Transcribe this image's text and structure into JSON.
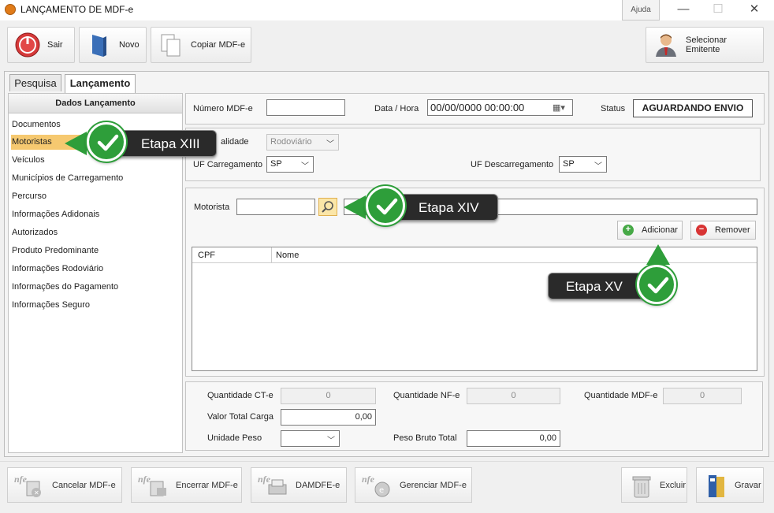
{
  "window": {
    "title": "LANÇAMENTO DE MDF-e",
    "help": "Ajuda",
    "min": "—",
    "max": "☐",
    "close": "✕"
  },
  "toolbar": {
    "exit": "Sair",
    "new": "Novo",
    "copy": "Copiar MDF-e",
    "select_issuer": "Selecionar Emitente"
  },
  "tabs": [
    "Pesquisa",
    "Lançamento"
  ],
  "sidebar": {
    "header": "Dados Lançamento",
    "items": [
      "Documentos",
      "Motoristas",
      "Veículos",
      "Municípios de Carregamento",
      "Percurso",
      "Informações Adidonais",
      "Autorizados",
      "Produto Predominante",
      "Informações Rodoviário",
      "Informações do Pagamento",
      "Informações Seguro"
    ]
  },
  "header_form": {
    "number_label": "Número MDF-e",
    "number_value": "",
    "datetime_label": "Data / Hora",
    "datetime_value": "00/00/0000 00:00:00",
    "status_label": "Status",
    "status_value": "AGUARDANDO ENVIO"
  },
  "mode_form": {
    "modality_label": "alidade",
    "modality_value": "Rodoviário",
    "uf_load_label": "UF Carregamento",
    "uf_load_value": "SP",
    "uf_unload_label": "UF Descarregamento",
    "uf_unload_value": "SP"
  },
  "driver_form": {
    "driver_label": "Motorista",
    "driver_value": "",
    "add_label": "Adicionar",
    "remove_label": "Remover",
    "columns": [
      "CPF",
      "Nome"
    ]
  },
  "totals": {
    "qty_cte_label": "Quantidade CT-e",
    "qty_cte_value": "0",
    "qty_nfe_label": "Quantidade NF-e",
    "qty_nfe_value": "0",
    "qty_mdfe_label": "Quantidade MDF-e",
    "qty_mdfe_value": "0",
    "total_load_label": "Valor Total Carga",
    "total_load_value": "0,00",
    "weight_unit_label": "Unidade Peso",
    "weight_unit_value": "",
    "gross_weight_label": "Peso Bruto Total",
    "gross_weight_value": "0,00"
  },
  "bottom": {
    "cancel": "Cancelar MDF-e",
    "close": "Encerrar MDF-e",
    "damdfe": "DAMDFE-e",
    "manage": "Gerenciar MDF-e",
    "delete": "Excluir",
    "save": "Gravar",
    "nfe_mark": "nfe"
  },
  "callouts": {
    "step13": "Etapa XIII",
    "step14": "Etapa XIV",
    "step15": "Etapa XV"
  },
  "colors": {
    "accent": "#f6c970",
    "check": "#2e9e3a",
    "callout_bg": "#2a2a2a"
  }
}
